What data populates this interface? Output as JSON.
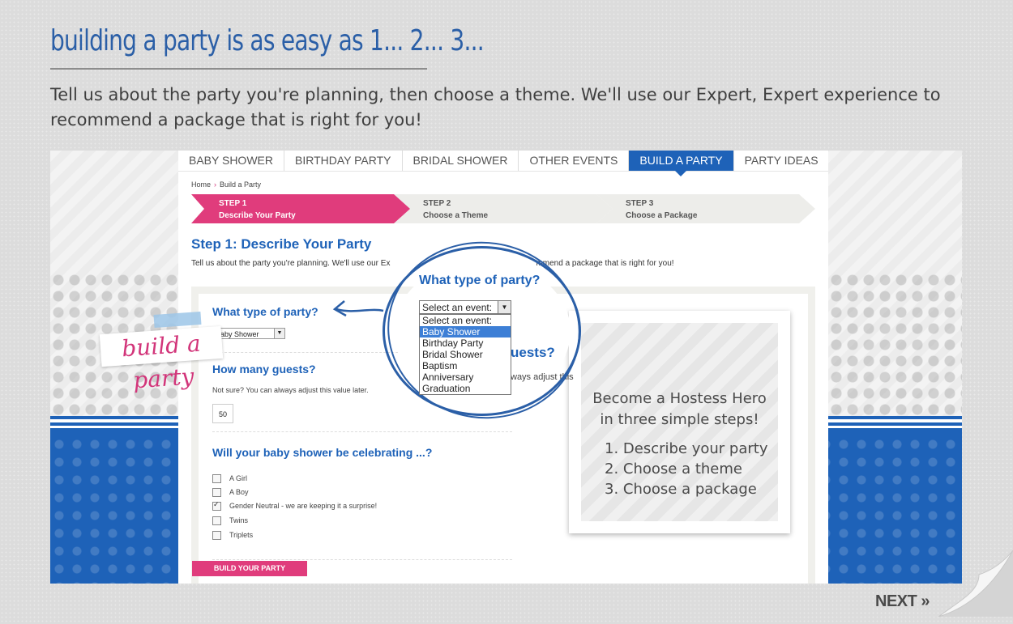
{
  "slide": {
    "title": "building a party is as easy as 1... 2... 3...",
    "intro": "Tell us about the party you're planning, then choose a theme. We'll use our Expert, Expert experience to recommend a package that is right for you!",
    "next_label": "NEXT",
    "next_icon": "double-chevron-right-icon"
  },
  "nav": {
    "items": [
      "BABY SHOWER",
      "BIRTHDAY PARTY",
      "BRIDAL SHOWER",
      "OTHER EVENTS",
      "BUILD A PARTY",
      "PARTY IDEAS"
    ],
    "active": "BUILD A PARTY"
  },
  "breadcrumb": {
    "home": "Home",
    "separator": "›",
    "current": "Build a Party"
  },
  "steps": [
    {
      "num": "STEP 1",
      "label": "Describe Your Party",
      "active": true
    },
    {
      "num": "STEP 2",
      "label": "Choose a Theme",
      "active": false
    },
    {
      "num": "STEP 3",
      "label": "Choose a Package",
      "active": false
    }
  ],
  "page": {
    "heading": "Step 1: Describe Your Party",
    "description_start": "Tell us about the party you're planning. We'll use our Ex",
    "description_end": "mmend a package that is right for you!"
  },
  "form": {
    "party_type_q": "What type of party?",
    "party_type_value": "Baby Shower",
    "guests_q": "How many guests?",
    "guests_note": "Not sure? You can always adjust this value later.",
    "guests_value": "50",
    "celebrating_q": "Will your baby shower be celebrating ...?",
    "options": [
      {
        "label": "A Girl",
        "checked": false
      },
      {
        "label": "A Boy",
        "checked": false
      },
      {
        "label": "Gender Neutral - we are keeping it a surprise!",
        "checked": true
      },
      {
        "label": "Twins",
        "checked": false
      },
      {
        "label": "Triplets",
        "checked": false
      }
    ],
    "submit_label": "BUILD YOUR PARTY"
  },
  "callout": {
    "question": "What type of party?",
    "select_value": "Select an event:",
    "dropdown_options": [
      "Select an event:",
      "Baby Shower",
      "Birthday Party",
      "Bridal Shower",
      "Baptism",
      "Anniversary",
      "Graduation"
    ],
    "highlighted": "Baby Shower",
    "partial_heading": "uests?",
    "partial_note": "ways adjust this"
  },
  "promo": {
    "logo": "build a party",
    "tagline_1": "Become a Hostess Hero",
    "tagline_2": "in three simple steps!",
    "steps": [
      "1. Describe your party",
      "2. Choose a theme",
      "3. Choose a package"
    ]
  },
  "colors": {
    "brand_blue": "#1e62b8",
    "brand_pink": "#e03c7c",
    "title_blue": "#2b5fa7"
  }
}
